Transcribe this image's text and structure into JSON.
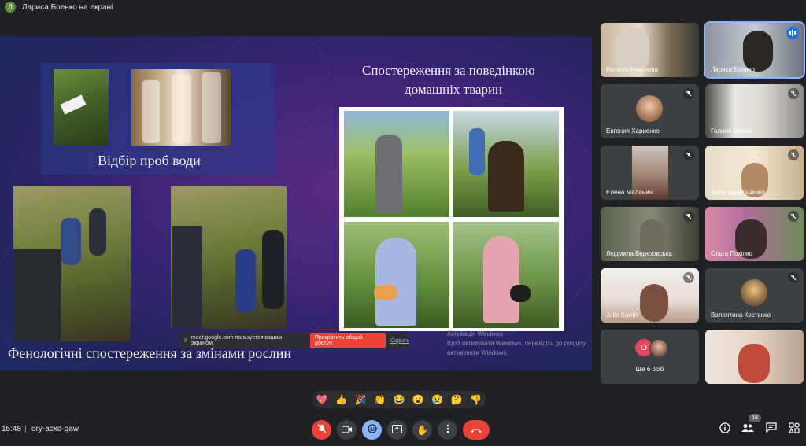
{
  "presenter": {
    "initial": "Л",
    "label": "Лариса Боенко на екрані"
  },
  "slide": {
    "water_title": "Відбір проб води",
    "behavior_title_line1": "Спостереження за поведінкою",
    "behavior_title_line2": "домашніх тварин",
    "phenology_title": "Фенологічні спостереження за змінами рослин",
    "watermark_line1": "Активація Windows",
    "watermark_line2": "Щоб активувати Windows, перейдіть до розділу",
    "watermark_line3": "активувати Windows."
  },
  "share_banner": {
    "text": "meet.google.com пользуется вашим экраном.",
    "stop_label": "Прекратить общий доступ",
    "hide_label": "Скрыть"
  },
  "participants": [
    {
      "name": "Наталія Рикунова"
    },
    {
      "name": "Лариса Боенко"
    },
    {
      "name": "Евгения Хариенко"
    },
    {
      "name": "Галина Мирна"
    },
    {
      "name": "Елена Маланич"
    },
    {
      "name": "Анна Данильченко"
    },
    {
      "name": "Людмила Березовська"
    },
    {
      "name": "Ольга Похілко"
    },
    {
      "name": "Julia Soroh"
    },
    {
      "name": "Валентина Костенко"
    },
    {
      "name": "Ще 6 осіб",
      "avatar_initial": "O"
    },
    {
      "name": ""
    }
  ],
  "reactions": [
    "💖",
    "👍",
    "🎉",
    "👏",
    "😂",
    "😮",
    "😢",
    "🤔",
    "👎"
  ],
  "bottom": {
    "time": "15:48",
    "separator": "|",
    "meeting_code": "ory-acxd-qaw",
    "people_count": "18"
  },
  "colors": {
    "end_call": "#ea4335",
    "mic_off": "#ea4335",
    "accent": "#8ab4f8",
    "bar_bg": "#202124"
  }
}
